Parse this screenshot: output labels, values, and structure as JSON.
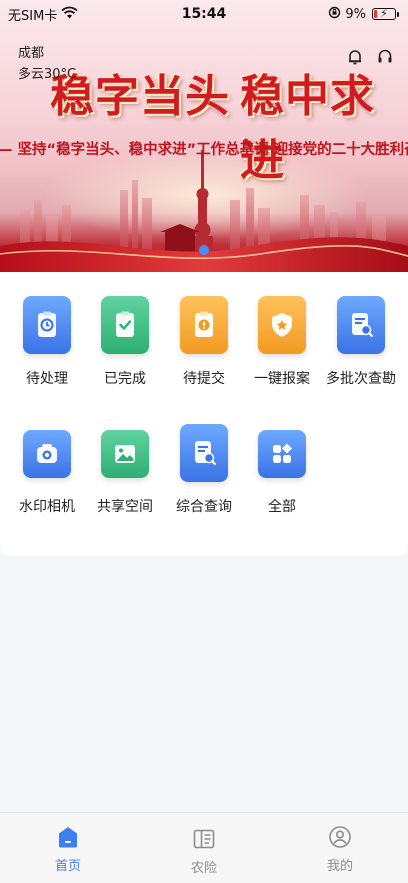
{
  "status_bar": {
    "carrier": "无SIM卡",
    "time": "15:44",
    "battery": "9%",
    "icons": [
      "wifi-icon",
      "orientation-lock-icon",
      "battery-charging-icon"
    ]
  },
  "location": {
    "city": "成都",
    "weather": "多云30°C"
  },
  "header_icons": [
    "bell-icon",
    "headset-icon"
  ],
  "banner": {
    "slogan_left": "稳字当头",
    "slogan_right": "稳中求进",
    "subline": "— 坚持“稳字当头、稳中求进”工作总基调 迎接党的二十大胜利召",
    "page_index": 1
  },
  "grid": {
    "items": [
      {
        "label": "待处理",
        "icon": "clock-clipboard-icon",
        "color": "blue"
      },
      {
        "label": "已完成",
        "icon": "check-clipboard-icon",
        "color": "green"
      },
      {
        "label": "待提交",
        "icon": "alert-clipboard-icon",
        "color": "orange"
      },
      {
        "label": "一键报案",
        "icon": "police-shield-icon",
        "color": "orange"
      },
      {
        "label": "多批次查勘",
        "icon": "document-search-icon",
        "color": "blue"
      },
      {
        "label": "水印相机",
        "icon": "camera-icon",
        "color": "blue"
      },
      {
        "label": "共享空间",
        "icon": "image-icon",
        "color": "green"
      },
      {
        "label": "综合查询",
        "icon": "document-search-icon",
        "color": "blue"
      },
      {
        "label": "全部",
        "icon": "apps-grid-icon",
        "color": "blue"
      }
    ]
  },
  "tabbar": {
    "tabs": [
      {
        "label": "首页",
        "icon": "home-icon",
        "active": true
      },
      {
        "label": "农险",
        "icon": "book-icon",
        "active": false
      },
      {
        "label": "我的",
        "icon": "user-icon",
        "active": false
      }
    ]
  },
  "colors": {
    "accent": "#3d7ff0",
    "blue_tile": "#4a85f0",
    "green_tile": "#3cbf84",
    "orange_tile": "#f5a731",
    "banner_red": "#d11a22"
  }
}
